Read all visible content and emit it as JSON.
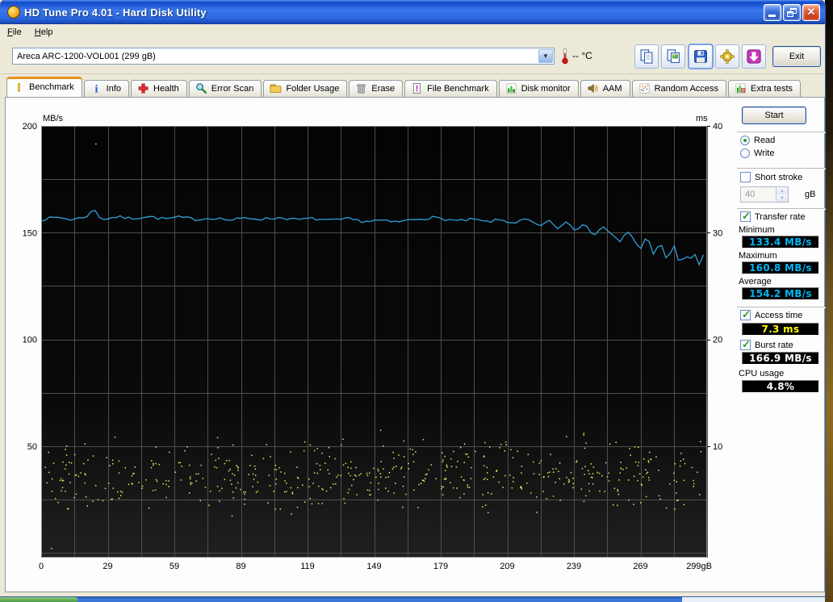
{
  "window": {
    "title": "HD Tune Pro 4.01 - Hard Disk Utility",
    "menu": [
      "File",
      "Help"
    ],
    "buttons": [
      "minimize",
      "restore",
      "close"
    ]
  },
  "toolbar": {
    "drive_selector": "Areca   ARC-1200-VOL001  (299 gB)",
    "temperature": "-- °C",
    "buttons": [
      "copy-text",
      "copy-image",
      "save-screenshot",
      "options",
      "captures"
    ],
    "exit_label": "Exit"
  },
  "tabs": [
    {
      "id": "benchmark",
      "label": "Benchmark",
      "active": true
    },
    {
      "id": "info",
      "label": "Info",
      "active": false
    },
    {
      "id": "health",
      "label": "Health",
      "active": false
    },
    {
      "id": "error-scan",
      "label": "Error Scan",
      "active": false
    },
    {
      "id": "folder-usage",
      "label": "Folder Usage",
      "active": false
    },
    {
      "id": "erase",
      "label": "Erase",
      "active": false
    },
    {
      "id": "file-benchmark",
      "label": "File Benchmark",
      "active": false
    },
    {
      "id": "disk-monitor",
      "label": "Disk monitor",
      "active": false
    },
    {
      "id": "aam",
      "label": "AAM",
      "active": false
    },
    {
      "id": "random-access",
      "label": "Random Access",
      "active": false
    },
    {
      "id": "extra-tests",
      "label": "Extra tests",
      "active": false
    }
  ],
  "benchmark": {
    "start_label": "Start",
    "mode": {
      "read_label": "Read",
      "write_label": "Write",
      "selected": "read"
    },
    "short_stroke": {
      "label": "Short stroke",
      "checked": false,
      "value": "40",
      "unit": "gB"
    },
    "transfer_rate": {
      "label": "Transfer rate",
      "checked": true,
      "minimum_label": "Minimum",
      "minimum": "133.4 MB/s",
      "maximum_label": "Maximum",
      "maximum": "160.8 MB/s",
      "average_label": "Average",
      "average": "154.2 MB/s"
    },
    "access_time": {
      "label": "Access time",
      "checked": true,
      "value": "7.3 ms"
    },
    "burst_rate": {
      "label": "Burst rate",
      "checked": true,
      "value": "166.9 MB/s"
    },
    "cpu_usage": {
      "label": "CPU usage",
      "value": "4.8%"
    }
  },
  "chart_data": {
    "type": "line",
    "title": "HD Tune read benchmark: transfer rate line (MB/s) with access-time scatter (ms)",
    "x_axis": {
      "min": 0,
      "max": 299,
      "unit": "gB",
      "tick_labels": [
        "0",
        "29",
        "59",
        "89",
        "119",
        "149",
        "179",
        "209",
        "239",
        "269",
        "299gB"
      ]
    },
    "y_left": {
      "label": "MB/s",
      "min": 0,
      "max": 200,
      "ticks": [
        200,
        150,
        100,
        50
      ]
    },
    "y_right": {
      "label": "ms",
      "min": 0,
      "max": 40,
      "ticks": [
        40,
        30,
        20,
        10
      ]
    },
    "grid": {
      "color": "#4e4e4e",
      "x_divisions": 20,
      "y_divisions": 8
    },
    "plot_bg_top": "#040404",
    "plot_bg_bottom": "#202020",
    "series": [
      {
        "name": "transfer-rate",
        "unit": "MB/s",
        "color": "#2f9fd8",
        "stats": {
          "min": 133.4,
          "max": 160.8,
          "avg": 154.2
        },
        "noise_amp": 0.7,
        "seed": 7,
        "sample_step_gb": 1.87,
        "profile": [
          [
            0,
            156.2
          ],
          [
            8,
            157.2
          ],
          [
            14,
            156.0
          ],
          [
            20,
            157.5
          ],
          [
            24,
            160.8
          ],
          [
            27,
            156.2
          ],
          [
            34,
            157.4
          ],
          [
            40,
            156.6
          ],
          [
            48,
            157.6
          ],
          [
            55,
            156.4
          ],
          [
            62,
            157.2
          ],
          [
            70,
            156.2
          ],
          [
            78,
            157.0
          ],
          [
            85,
            155.8
          ],
          [
            92,
            156.8
          ],
          [
            100,
            156.4
          ],
          [
            108,
            157.0
          ],
          [
            115,
            156.0
          ],
          [
            122,
            156.6
          ],
          [
            130,
            155.6
          ],
          [
            138,
            156.4
          ],
          [
            145,
            155.2
          ],
          [
            152,
            155.8
          ],
          [
            158,
            154.8
          ],
          [
            164,
            155.6
          ],
          [
            170,
            156.6
          ],
          [
            176,
            157.0
          ],
          [
            182,
            156.2
          ],
          [
            188,
            155.4
          ],
          [
            194,
            156.2
          ],
          [
            200,
            155.0
          ],
          [
            206,
            156.0
          ],
          [
            212,
            154.6
          ],
          [
            218,
            156.2
          ],
          [
            224,
            153.0
          ],
          [
            228,
            155.8
          ],
          [
            232,
            151.8
          ],
          [
            236,
            155.2
          ],
          [
            240,
            150.6
          ],
          [
            244,
            154.6
          ],
          [
            248,
            148.2
          ],
          [
            252,
            153.0
          ],
          [
            256,
            149.6
          ],
          [
            260,
            145.8
          ],
          [
            263,
            151.0
          ],
          [
            266,
            147.0
          ],
          [
            269,
            142.0
          ],
          [
            272,
            149.0
          ],
          [
            275,
            139.5
          ],
          [
            278,
            146.0
          ],
          [
            281,
            136.5
          ],
          [
            284,
            144.5
          ],
          [
            287,
            134.0
          ],
          [
            289,
            141.0
          ],
          [
            291,
            135.5
          ],
          [
            293,
            142.5
          ],
          [
            295,
            133.4
          ],
          [
            297,
            140.0
          ],
          [
            299,
            137.0
          ]
        ]
      },
      {
        "name": "access-time",
        "unit": "ms",
        "color": "#e8e860",
        "render": "scatter",
        "stats": {
          "avg": 7.3
        },
        "count": 540,
        "mean_ms": 7.3,
        "spread_ms": 3.0,
        "x_range": [
          1,
          298
        ],
        "seed": 13,
        "outliers": [
          [
            24.6,
            38.3
          ],
          [
            4.7,
            0.4
          ]
        ]
      }
    ]
  }
}
